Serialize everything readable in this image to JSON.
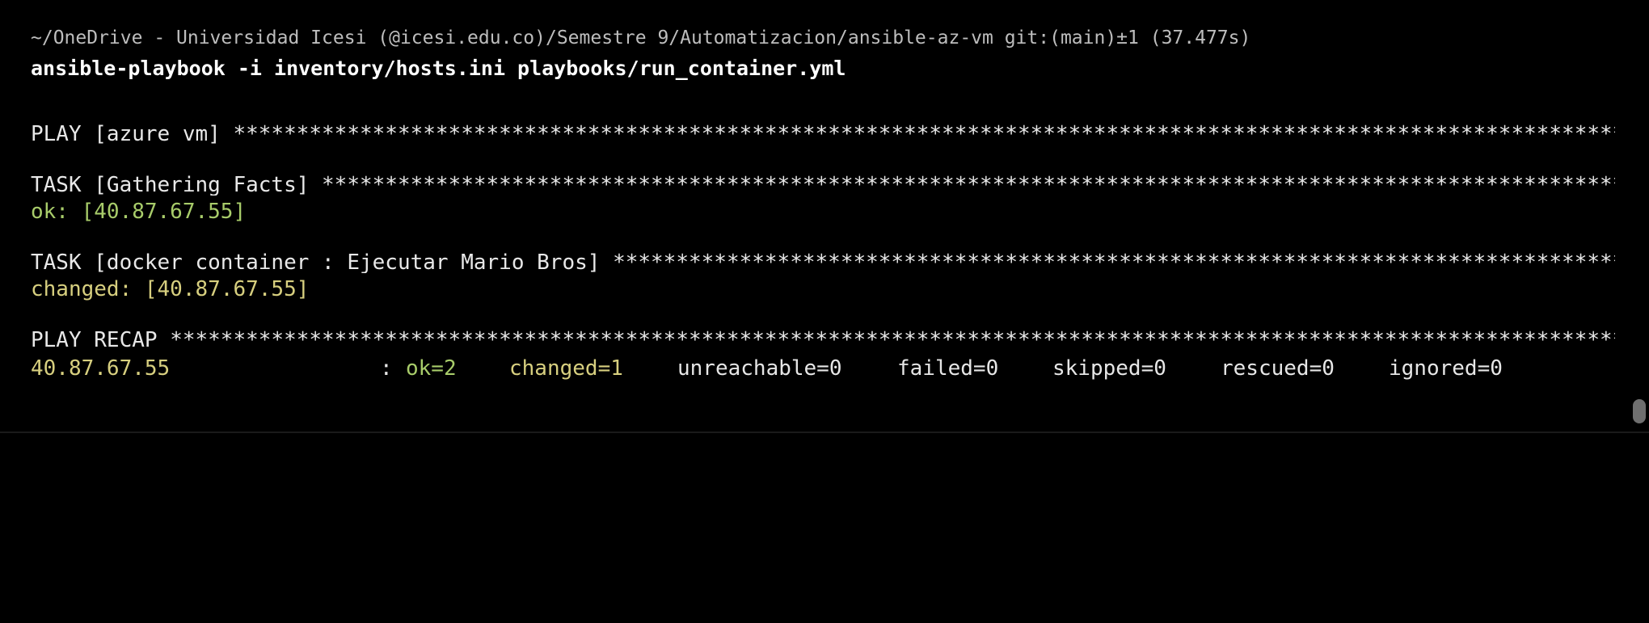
{
  "terminal": {
    "prompt": "~/OneDrive - Universidad Icesi (@icesi.edu.co)/Semestre 9/Automatizacion/ansible-az-vm git:(main)±1 (37.477s)",
    "command": "ansible-playbook -i inventory/hosts.ini playbooks/run_container.yml",
    "play_header": "PLAY [azure_vm] ",
    "play_stars": "**************************************************************************************************************************************************",
    "task1_header": "TASK [Gathering Facts] ",
    "task1_stars": "*************************************************************************************************************************************",
    "task1_result": "ok: [40.87.67.55]",
    "task2_header": "TASK [docker_container : Ejecutar Mario Bros] ",
    "task2_stars": "*************************************************************************************************************",
    "task2_result": "changed: [40.87.67.55]",
    "recap_header": "PLAY RECAP ",
    "recap_stars": "*****************************************************************************************************************************************************",
    "recap": {
      "host": "40.87.67.55",
      "colon": ":",
      "ok": "ok=2",
      "changed": "changed=1",
      "unreachable": "unreachable=0",
      "failed": "failed=0",
      "skipped": "skipped=0",
      "rescued": "rescued=0",
      "ignored": "ignored=0"
    }
  },
  "colors": {
    "background": "#000000",
    "ok_green": "#a8cc6a",
    "changed_yellow": "#d7cf7f",
    "text": "#e8e8e8"
  }
}
